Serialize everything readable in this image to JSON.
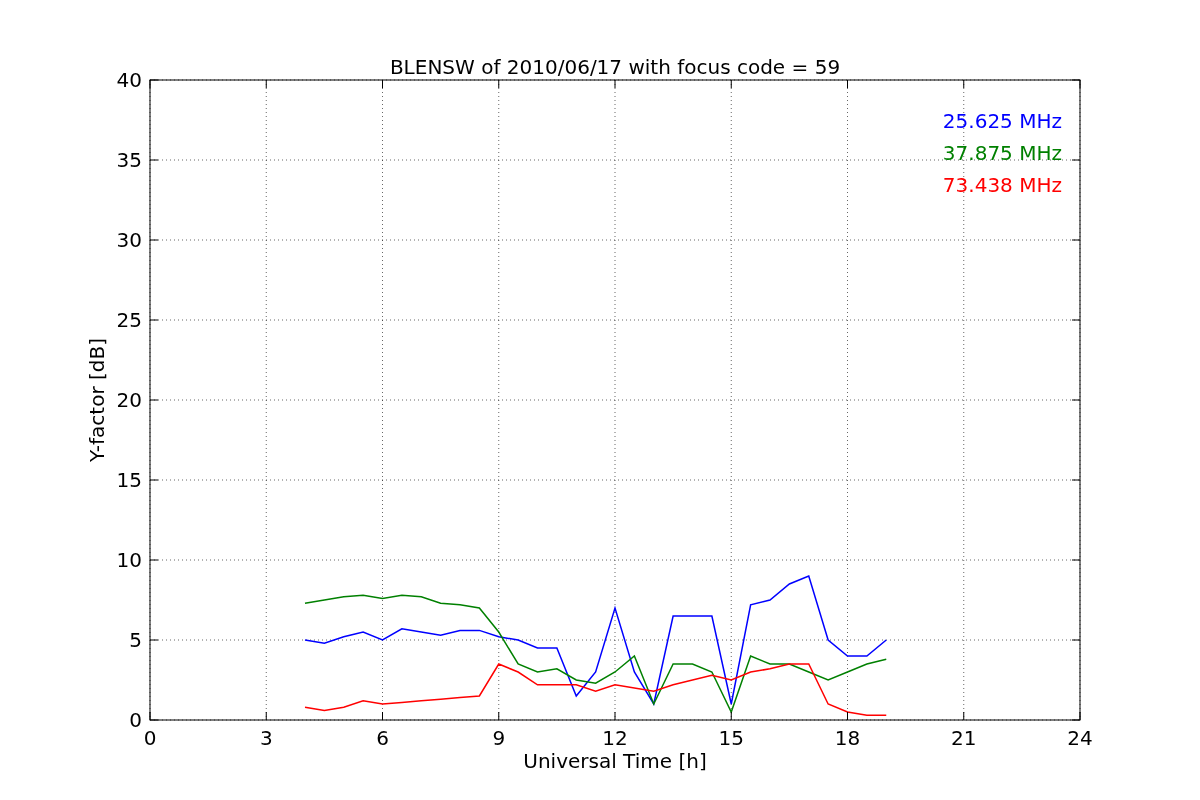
{
  "chart_data": {
    "type": "line",
    "title": "BLENSW of 2010/06/17 with focus code = 59",
    "xlabel": "Universal Time [h]",
    "ylabel": "Y-factor [dB]",
    "x": [
      4,
      4.5,
      5,
      5.5,
      6,
      6.5,
      7,
      7.5,
      8,
      8.5,
      9,
      9.5,
      10,
      10.5,
      11,
      11.5,
      12,
      12.5,
      13,
      13.5,
      14,
      14.5,
      15,
      15.5,
      16,
      16.5,
      17,
      17.5,
      18,
      18.5,
      19
    ],
    "series": [
      {
        "name": "25.625 MHz",
        "color": "#0000ff",
        "values": [
          5,
          4.8,
          5.2,
          5.5,
          5,
          5.7,
          5.5,
          5.3,
          5.6,
          5.6,
          5.2,
          5,
          4.5,
          4.5,
          1.5,
          3,
          7,
          3,
          1,
          6.5,
          6.5,
          6.5,
          1,
          7.2,
          7.5,
          8.5,
          9,
          5,
          4,
          4,
          5
        ]
      },
      {
        "name": "37.875 MHz",
        "color": "#008000",
        "values": [
          7.3,
          7.5,
          7.7,
          7.8,
          7.6,
          7.8,
          7.7,
          7.3,
          7.2,
          7,
          5.5,
          3.5,
          3,
          3.2,
          2.5,
          2.3,
          3,
          4,
          1,
          3.5,
          3.5,
          3,
          0.5,
          4,
          3.5,
          3.5,
          3,
          2.5,
          3,
          3.5,
          3.8
        ]
      },
      {
        "name": "73.438 MHz",
        "color": "#ff0000",
        "values": [
          0.8,
          0.6,
          0.8,
          1.2,
          1,
          1.1,
          1.2,
          1.3,
          1.4,
          1.5,
          3.5,
          3,
          2.2,
          2.2,
          2.2,
          1.8,
          2.2,
          2,
          1.8,
          2.2,
          2.5,
          2.8,
          2.5,
          3,
          3.2,
          3.5,
          3.5,
          1,
          0.5,
          0.3,
          0.3
        ]
      }
    ],
    "xlim": [
      0,
      24
    ],
    "ylim": [
      0,
      40
    ],
    "xticks": [
      0,
      3,
      6,
      9,
      12,
      15,
      18,
      21,
      24
    ],
    "yticks": [
      0,
      5,
      10,
      15,
      20,
      25,
      30,
      35,
      40
    ],
    "grid": true
  }
}
